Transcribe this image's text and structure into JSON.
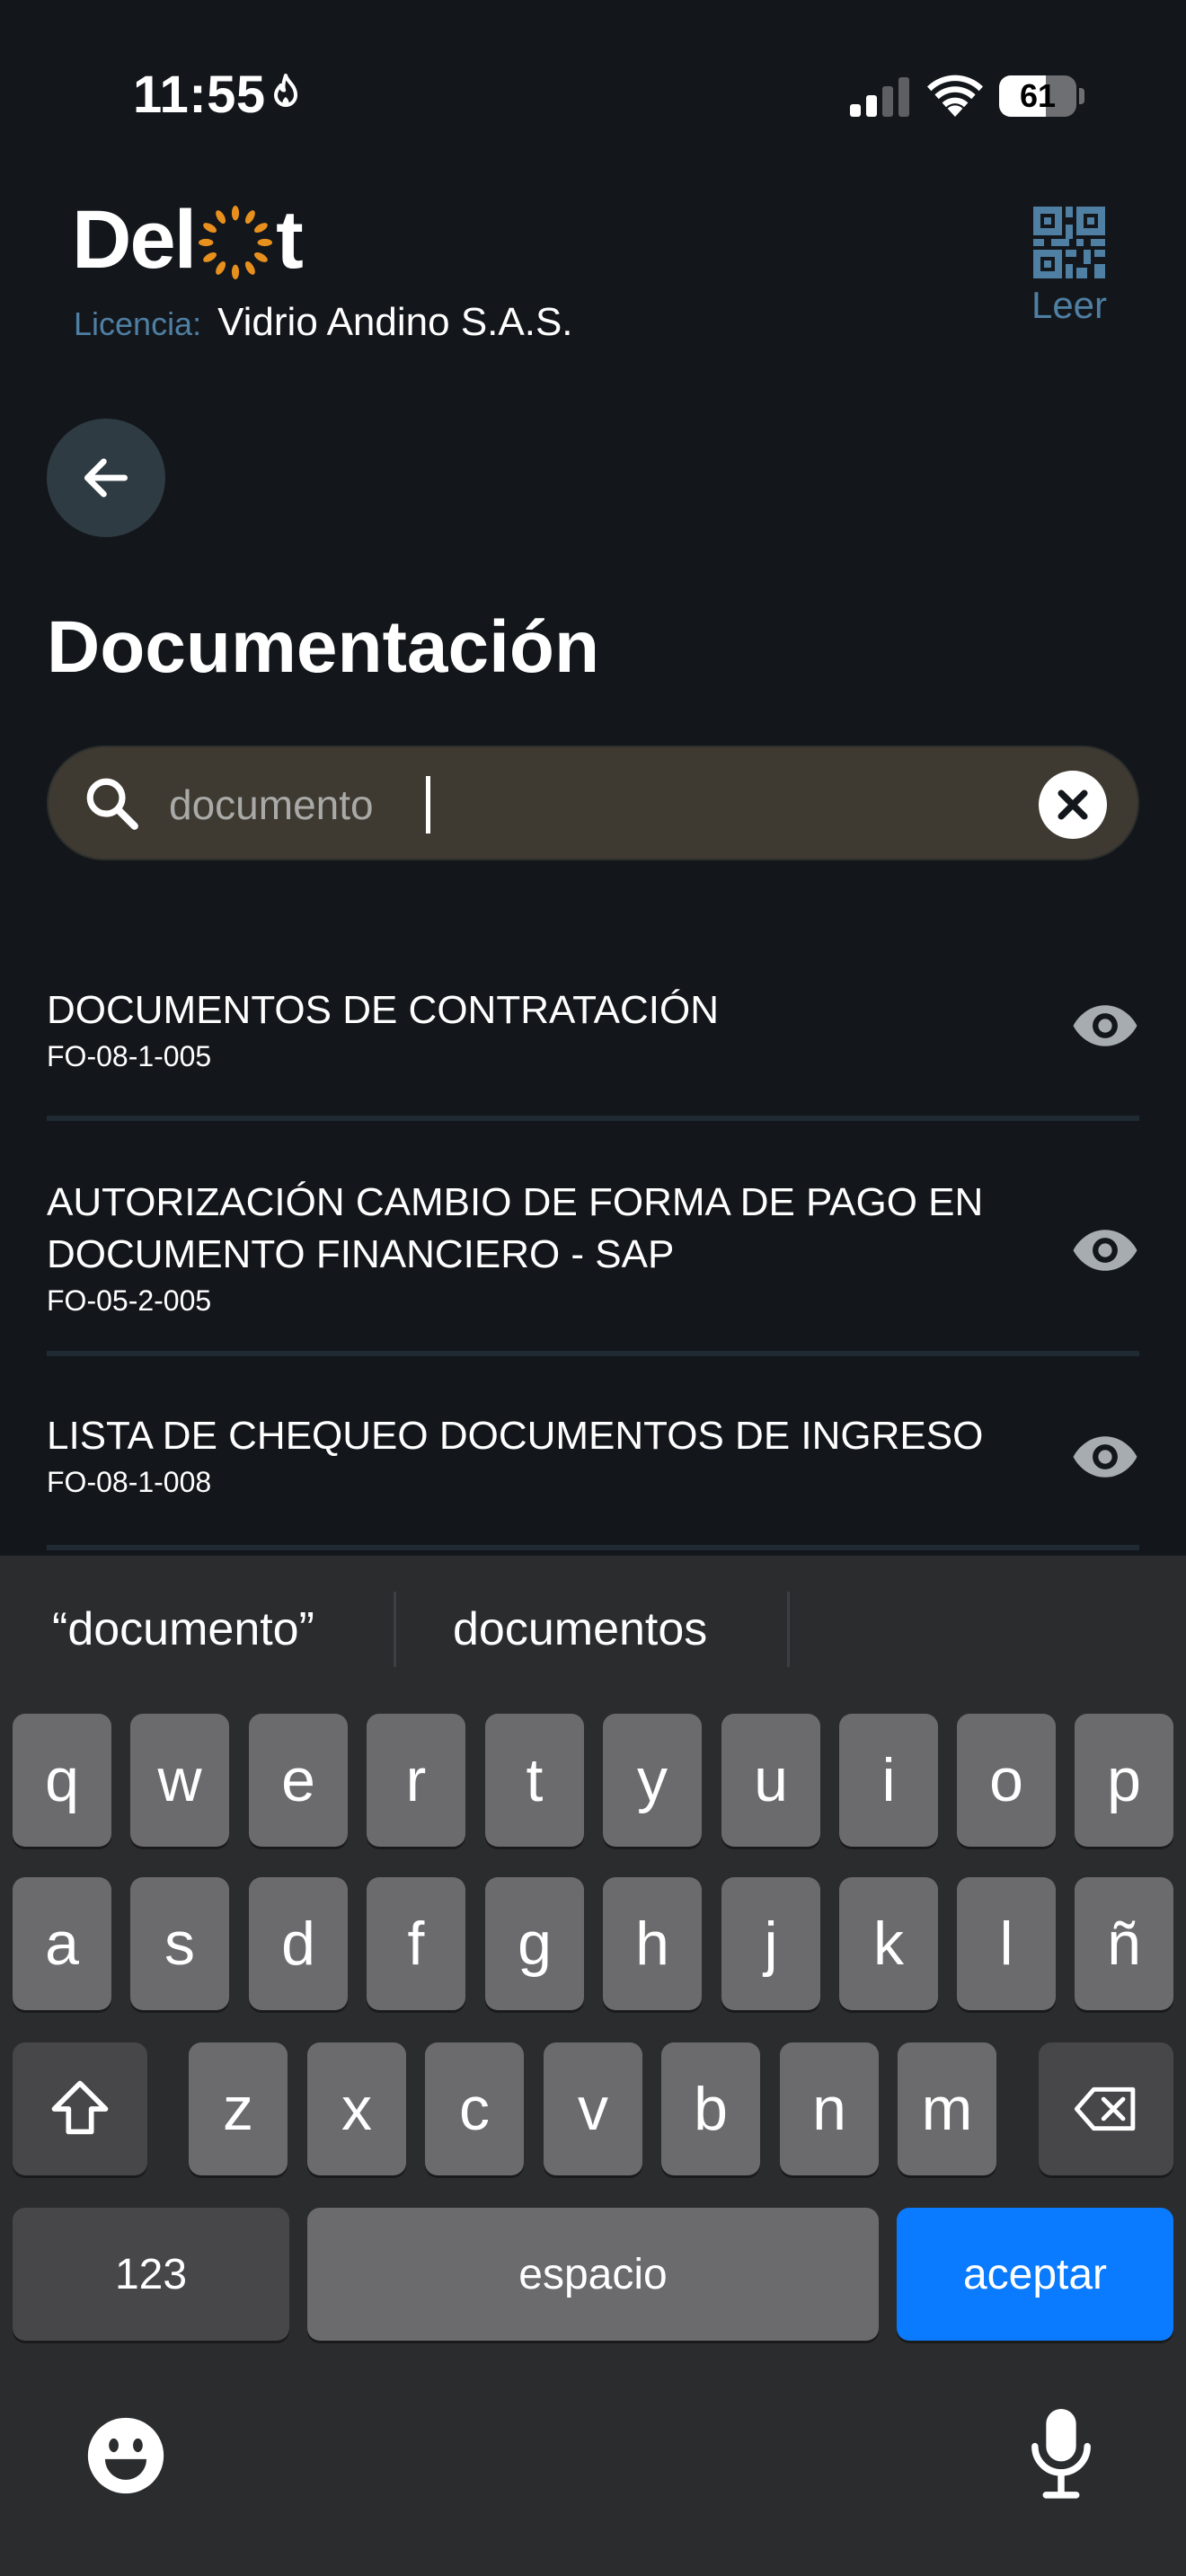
{
  "status_bar": {
    "time": "11:55",
    "battery": "61",
    "battery_level": 0.61
  },
  "header": {
    "logo_text_left": "Del",
    "logo_text_right": "t",
    "licence_label": "Licencia:",
    "licence_value": "Vidrio Andino S.A.S.",
    "qr_label": "Leer"
  },
  "page": {
    "title": "Documentación"
  },
  "search": {
    "value": "documento",
    "placeholder": ""
  },
  "documents": [
    {
      "title": "DOCUMENTOS DE CONTRATACIÓN",
      "code": "FO-08-1-005"
    },
    {
      "title": "AUTORIZACIÓN CAMBIO DE FORMA DE PAGO EN DOCUMENTO FINANCIERO - SAP",
      "code": "FO-05-2-005"
    },
    {
      "title": "LISTA DE CHEQUEO DOCUMENTOS DE INGRESO",
      "code": "FO-08-1-008"
    }
  ],
  "keyboard": {
    "suggestions": [
      "“documento”",
      "documentos"
    ],
    "row1": [
      "q",
      "w",
      "e",
      "r",
      "t",
      "y",
      "u",
      "i",
      "o",
      "p"
    ],
    "row2": [
      "a",
      "s",
      "d",
      "f",
      "g",
      "h",
      "j",
      "k",
      "l",
      "ñ"
    ],
    "row3": [
      "z",
      "x",
      "c",
      "v",
      "b",
      "n",
      "m"
    ],
    "numbers_key": "123",
    "space_key": "espacio",
    "return_key": "aceptar"
  },
  "colors": {
    "background": "#13171b",
    "accent_blue": "#4f7fa3",
    "return_key": "#0a7aff",
    "logo_orange": "#e8901e"
  }
}
